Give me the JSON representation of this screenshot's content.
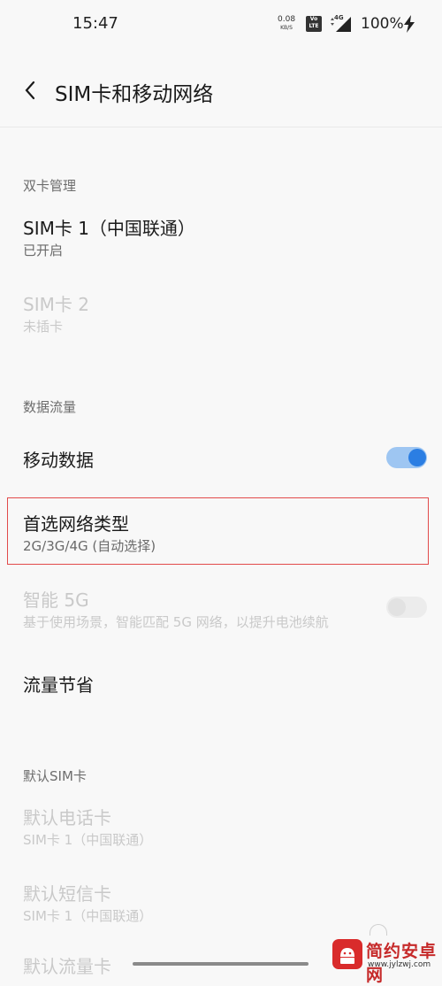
{
  "status": {
    "time": "15:47",
    "speed_value": "0.08",
    "speed_unit": "KB/S",
    "volte": "Vo LTE",
    "network": "4G",
    "battery": "100%"
  },
  "header": {
    "title": "SIM卡和移动网络"
  },
  "sections": {
    "dual_sim": {
      "label": "双卡管理",
      "sim1": {
        "title": "SIM卡 1（中国联通）",
        "subtitle": "已开启"
      },
      "sim2": {
        "title": "SIM卡 2",
        "subtitle": "未插卡"
      }
    },
    "data_traffic": {
      "label": "数据流量",
      "mobile_data": {
        "title": "移动数据",
        "enabled": true
      },
      "preferred_network": {
        "title": "首选网络类型",
        "subtitle": "2G/3G/4G (自动选择)"
      },
      "smart_5g": {
        "title": "智能 5G",
        "subtitle": "基于使用场景，智能匹配 5G 网络，以提升电池续航",
        "enabled": false
      },
      "data_saver": {
        "title": "流量节省"
      }
    },
    "default_sim": {
      "label": "默认SIM卡",
      "calls": {
        "title": "默认电话卡",
        "subtitle": "SIM卡 1（中国联通）"
      },
      "sms": {
        "title": "默认短信卡",
        "subtitle": "SIM卡 1（中国联通）"
      },
      "data": {
        "title": "默认流量卡"
      }
    }
  },
  "watermark": {
    "name": "简约安卓网",
    "url": "www.jylzwj.com"
  },
  "colors": {
    "accent": "#2b7ee3",
    "highlight": "#e24b4b",
    "background": "#f8f8f8"
  }
}
